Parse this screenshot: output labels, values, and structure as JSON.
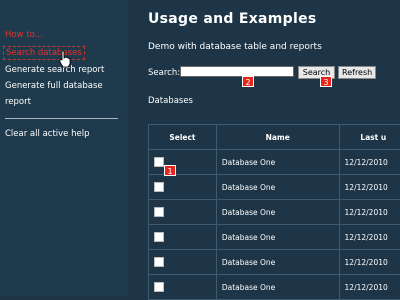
{
  "sidebar": {
    "links": [
      {
        "label": "How to..."
      },
      {
        "label": "Search databases"
      },
      {
        "label": "Generate search report"
      },
      {
        "label": "Generate full database"
      },
      {
        "label": "report"
      },
      {
        "label": "Clear all active help"
      }
    ]
  },
  "main": {
    "title": "Usage and Examples",
    "subtitle": "Demo with database table and reports",
    "search_label": "Search:",
    "search_value": "",
    "search_button": "Search",
    "refresh_button": "Refresh",
    "section_label": "Databases",
    "badges": [
      "1",
      "2",
      "3"
    ]
  },
  "table": {
    "headers": [
      "Select",
      "Name",
      "Last u"
    ],
    "rows": [
      {
        "name": "Database One",
        "date": "12/12/2010"
      },
      {
        "name": "Database One",
        "date": "12/12/2010"
      },
      {
        "name": "Database One",
        "date": "12/12/2010"
      },
      {
        "name": "Database One",
        "date": "12/12/2010"
      },
      {
        "name": "Database One",
        "date": "12/12/2010"
      },
      {
        "name": "Database One",
        "date": "12/12/2010"
      }
    ]
  },
  "colors": {
    "background": "#1d3546",
    "sidebar": "#1f3a4d",
    "highlight_red": "#e0342b",
    "badge": "#e8261b"
  }
}
